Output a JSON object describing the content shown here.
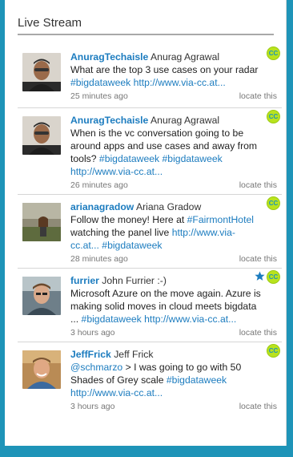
{
  "panel": {
    "title": "Live Stream"
  },
  "badge_label": "CC",
  "tweets": [
    {
      "handle": "AnuragTechaisle",
      "name": "Anurag Agrawal",
      "text": "What are the top 3 use cases on your radar ",
      "tag1": "#bigdataweek",
      "link": "http://www.via-cc.at...",
      "time": "25 minutes ago",
      "locate": "locate this"
    },
    {
      "handle": "AnuragTechaisle",
      "name": "Anurag Agrawal",
      "text": "When is the vc conversation going to be around apps and use cases and away from tools? ",
      "tag1": "#bigdataweek",
      "tag2": "#bigdataweek",
      "link": "http://www.via-cc.at...",
      "time": "26 minutes ago",
      "locate": "locate this"
    },
    {
      "handle": "arianagradow",
      "name": "Ariana Gradow",
      "text": "Follow the money! Here at ",
      "tag1": "#FairmontHotel",
      "text2": " watching the panel live ",
      "link": "http://www.via-cc.at...",
      "tag2": "#bigdataweek",
      "time": "28 minutes ago",
      "locate": "locate this"
    },
    {
      "handle": "furrier",
      "name": "John Furrier :-)",
      "text": "Microsoft Azure on the move again. Azure is making solid moves in cloud meets bigdata ... ",
      "tag1": "#bigdataweek",
      "link": "http://www.via-cc.at...",
      "time": "3 hours ago",
      "locate": "locate this"
    },
    {
      "handle": "JeffFrick",
      "name": "Jeff Frick",
      "mention": "@schmarzo",
      "text": " > I was going to go with 50 Shades of Grey scale ",
      "tag1": "#bigdataweek",
      "link": "http://www.via-cc.at...",
      "time": "3 hours ago",
      "locate": "locate this"
    }
  ],
  "colors": {
    "background": "#1e94b8",
    "link": "#1c7cbf",
    "badge": "#b9e31d",
    "star": "#1c7cbf"
  },
  "icons": {
    "badge": "cc-badge-icon",
    "favorite": "star-icon"
  }
}
